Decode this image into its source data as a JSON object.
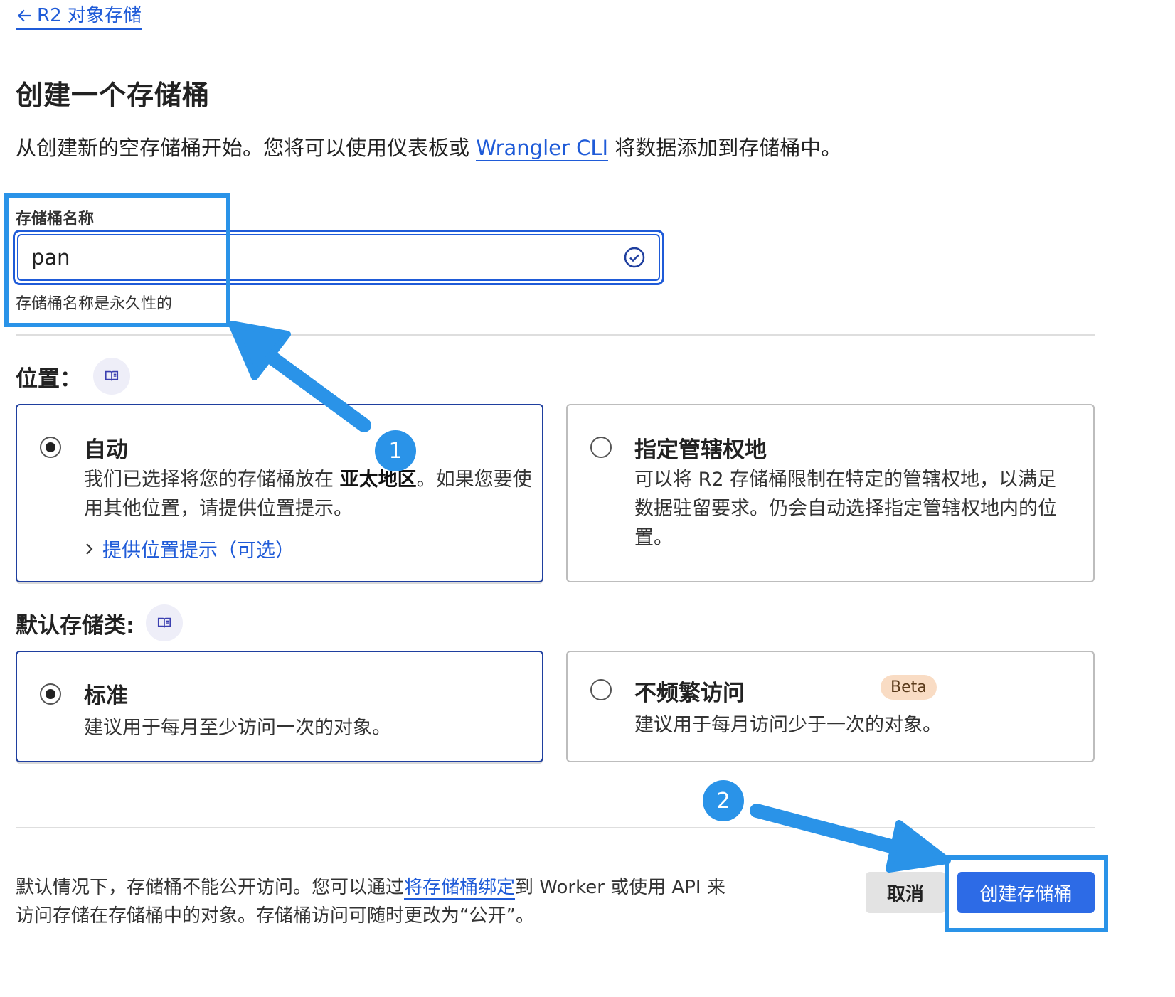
{
  "nav": {
    "back_label": "R2 对象存储"
  },
  "page": {
    "title": "创建一个存储桶",
    "description_pre": "从创建新的空存储桶开始。您将可以使用仪表板或 ",
    "description_link": "Wrangler CLI",
    "description_post": " 将数据添加到存储桶中。"
  },
  "bucket_name": {
    "label": "存储桶名称",
    "value": "pan",
    "hint": "存储桶名称是永久性的"
  },
  "location": {
    "label": "位置：",
    "auto": {
      "title": "自动",
      "body_pre": "我们已选择将您的存储桶放在 ",
      "body_region": "亚太地区",
      "body_post": "。如果您要使用其他位置，请提供位置提示。",
      "hint_link": "提供位置提示（可选）",
      "selected": true
    },
    "jurisdiction": {
      "title": "指定管辖权地",
      "body": "可以将 R2 存储桶限制在特定的管辖权地，以满足数据驻留要求。仍会自动选择指定管辖权地内的位置。",
      "selected": false
    }
  },
  "storage_class": {
    "label": "默认存储类:",
    "standard": {
      "title": "标准",
      "body": "建议用于每月至少访问一次的对象。",
      "selected": true
    },
    "infrequent": {
      "title": "不频繁访问",
      "badge": "Beta",
      "body": "建议用于每月访问少于一次的对象。",
      "selected": false
    }
  },
  "footer": {
    "text_pre": "默认情况下，存储桶不能公开访问。您可以通过",
    "text_link": "将存储桶绑定",
    "text_post": "到 Worker 或使用 API 来访问存储在存储桶中的对象。存储桶访问可随时更改为“公开”。",
    "cancel_label": "取消",
    "create_label": "创建存储桶"
  },
  "annotations": {
    "marker_1": "1",
    "marker_2": "2",
    "accent_color": "#2a93e8"
  },
  "colors": {
    "link": "#1f5bd8",
    "primary_button": "#2d6be6",
    "badge_bg": "#f9dcc4"
  }
}
